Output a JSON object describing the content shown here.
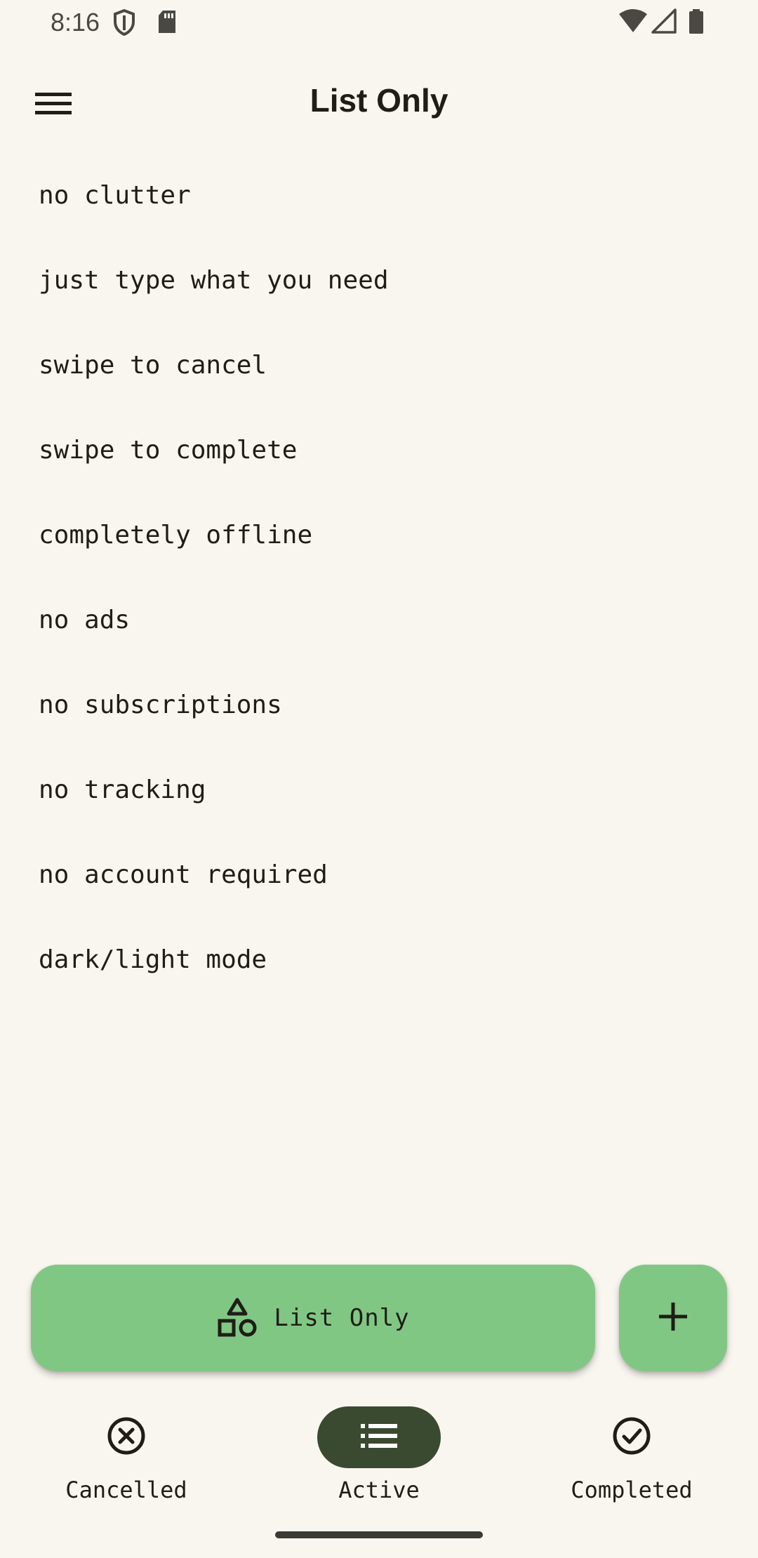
{
  "status_bar": {
    "time": "8:16",
    "icons": [
      "shield-icon",
      "sd-card-icon",
      "wifi-icon",
      "signal-icon",
      "battery-icon"
    ]
  },
  "app_bar": {
    "title": "List Only",
    "menu_icon": "hamburger-menu-icon"
  },
  "tasks": [
    "no clutter",
    "just type what you need",
    "swipe to cancel",
    "swipe to complete",
    "completely offline",
    "no ads",
    "no subscriptions",
    "no tracking",
    "no account required",
    "dark/light mode"
  ],
  "list_selector": {
    "label": "List Only",
    "icon": "shapes-icon"
  },
  "add_button": {
    "icon": "plus-icon"
  },
  "bottom_nav": {
    "items": [
      {
        "label": "Cancelled",
        "icon": "cancel-circle-icon",
        "active": false
      },
      {
        "label": "Active",
        "icon": "list-icon",
        "active": true
      },
      {
        "label": "Completed",
        "icon": "check-circle-icon",
        "active": false
      }
    ]
  },
  "colors": {
    "background": "#f9f6f0",
    "accent_green": "#81c784",
    "active_pill": "#3a4a30",
    "text": "#1f1d17"
  }
}
